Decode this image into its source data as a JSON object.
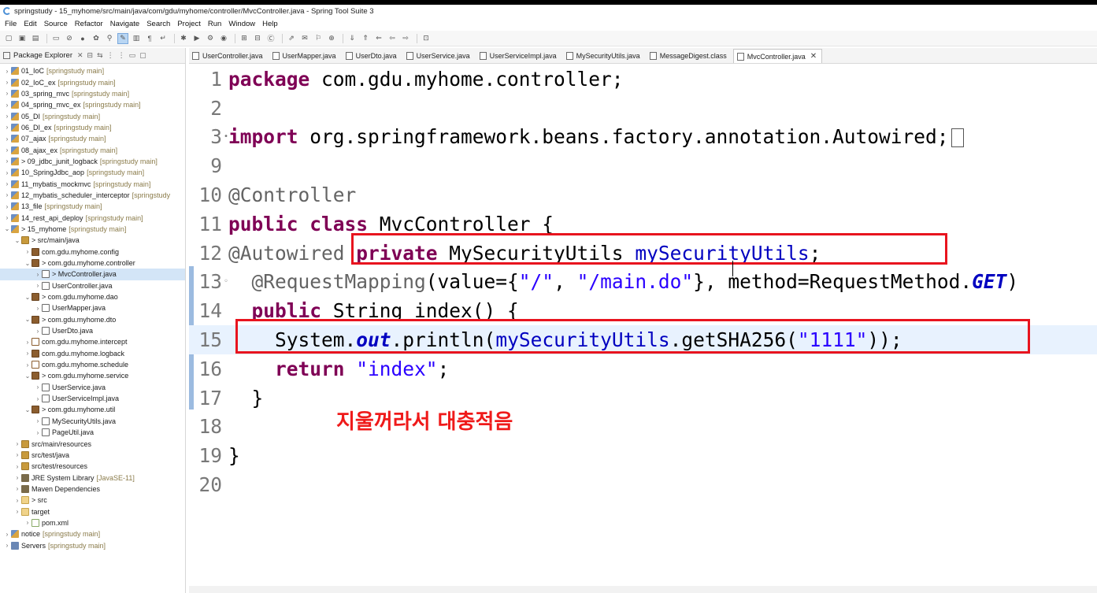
{
  "window": {
    "title": "springstudy - 15_myhome/src/main/java/com/gdu/myhome/controller/MvcController.java - Spring Tool Suite 3"
  },
  "menu": [
    "File",
    "Edit",
    "Source",
    "Refactor",
    "Navigate",
    "Search",
    "Project",
    "Run",
    "Window",
    "Help"
  ],
  "package_explorer": {
    "title": "Package Explorer",
    "rows": [
      {
        "name": "01_IoC",
        "tag": "[springstudy main]",
        "indent": 0,
        "icon": "proj"
      },
      {
        "name": "02_IoC_ex",
        "tag": "[springstudy main]",
        "indent": 0,
        "icon": "proj"
      },
      {
        "name": "03_spring_mvc",
        "tag": "[springstudy main]",
        "indent": 0,
        "icon": "proj"
      },
      {
        "name": "04_spring_mvc_ex",
        "tag": "[springstudy main]",
        "indent": 0,
        "icon": "proj"
      },
      {
        "name": "05_DI",
        "tag": "[springstudy main]",
        "indent": 0,
        "icon": "proj"
      },
      {
        "name": "06_DI_ex",
        "tag": "[springstudy main]",
        "indent": 0,
        "icon": "proj"
      },
      {
        "name": "07_ajax",
        "tag": "[springstudy main]",
        "indent": 0,
        "icon": "proj"
      },
      {
        "name": "08_ajax_ex",
        "tag": "[springstudy main]",
        "indent": 0,
        "icon": "proj"
      },
      {
        "name": "> 09_jdbc_junit_logback",
        "tag": "[springstudy main]",
        "indent": 0,
        "icon": "proj"
      },
      {
        "name": "10_SpringJdbc_aop",
        "tag": "[springstudy main]",
        "indent": 0,
        "icon": "proj"
      },
      {
        "name": "11_mybatis_mockmvc",
        "tag": "[springstudy main]",
        "indent": 0,
        "icon": "proj"
      },
      {
        "name": "12_mybatis_scheduler_interceptor",
        "tag": "[springstudy",
        "indent": 0,
        "icon": "proj"
      },
      {
        "name": "13_file",
        "tag": "[springstudy main]",
        "indent": 0,
        "icon": "proj"
      },
      {
        "name": "14_rest_api_deploy",
        "tag": "[springstudy main]",
        "indent": 0,
        "icon": "proj"
      },
      {
        "name": "> 15_myhome",
        "tag": "[springstudy main]",
        "indent": 0,
        "icon": "proj",
        "open": true
      },
      {
        "name": "> src/main/java",
        "tag": "",
        "indent": 1,
        "icon": "srcf",
        "open": true
      },
      {
        "name": "com.gdu.myhome.config",
        "tag": "",
        "indent": 2,
        "icon": "pkg"
      },
      {
        "name": "> com.gdu.myhome.controller",
        "tag": "",
        "indent": 2,
        "icon": "pkg",
        "open": true
      },
      {
        "name": "> MvcController.java",
        "tag": "",
        "indent": 3,
        "icon": "jfile",
        "selected": true
      },
      {
        "name": "UserController.java",
        "tag": "",
        "indent": 3,
        "icon": "jfile"
      },
      {
        "name": "> com.gdu.myhome.dao",
        "tag": "",
        "indent": 2,
        "icon": "pkg",
        "open": true
      },
      {
        "name": "UserMapper.java",
        "tag": "",
        "indent": 3,
        "icon": "jfile"
      },
      {
        "name": "> com.gdu.myhome.dto",
        "tag": "",
        "indent": 2,
        "icon": "pkg",
        "open": true
      },
      {
        "name": "UserDto.java",
        "tag": "",
        "indent": 3,
        "icon": "jfile"
      },
      {
        "name": "com.gdu.myhome.intercept",
        "tag": "",
        "indent": 2,
        "icon": "pkge"
      },
      {
        "name": "com.gdu.myhome.logback",
        "tag": "",
        "indent": 2,
        "icon": "pkg"
      },
      {
        "name": "com.gdu.myhome.schedule",
        "tag": "",
        "indent": 2,
        "icon": "pkge"
      },
      {
        "name": "> com.gdu.myhome.service",
        "tag": "",
        "indent": 2,
        "icon": "pkg",
        "open": true
      },
      {
        "name": "UserService.java",
        "tag": "",
        "indent": 3,
        "icon": "jfile"
      },
      {
        "name": "UserServiceImpl.java",
        "tag": "",
        "indent": 3,
        "icon": "jfile"
      },
      {
        "name": "> com.gdu.myhome.util",
        "tag": "",
        "indent": 2,
        "icon": "pkg",
        "open": true
      },
      {
        "name": "MySecurityUtils.java",
        "tag": "",
        "indent": 3,
        "icon": "jfile"
      },
      {
        "name": "PageUtil.java",
        "tag": "",
        "indent": 3,
        "icon": "jfile"
      },
      {
        "name": "src/main/resources",
        "tag": "",
        "indent": 1,
        "icon": "srcf"
      },
      {
        "name": "src/test/java",
        "tag": "",
        "indent": 1,
        "icon": "srcf"
      },
      {
        "name": "src/test/resources",
        "tag": "",
        "indent": 1,
        "icon": "srcf"
      },
      {
        "name": "JRE System Library",
        "tag": "[JavaSE-11]",
        "indent": 1,
        "icon": "lib"
      },
      {
        "name": "Maven Dependencies",
        "tag": "",
        "indent": 1,
        "icon": "lib"
      },
      {
        "name": "> src",
        "tag": "",
        "indent": 1,
        "icon": "fold"
      },
      {
        "name": "target",
        "tag": "",
        "indent": 1,
        "icon": "fold"
      },
      {
        "name": "pom.xml",
        "tag": "",
        "indent": 2,
        "icon": "xml"
      },
      {
        "name": "notice",
        "tag": "[springstudy main]",
        "indent": 0,
        "icon": "proj"
      },
      {
        "name": "Servers",
        "tag": "[springstudy main]",
        "indent": 0,
        "icon": "serv"
      }
    ]
  },
  "editor_tabs": [
    "UserController.java",
    "UserMapper.java",
    "UserDto.java",
    "UserService.java",
    "UserServiceImpl.java",
    "MySecurityUtils.java",
    "MessageDigest.class",
    "MvcController.java"
  ],
  "active_tab": "MvcController.java",
  "code": {
    "line_numbers": [
      "1",
      "2",
      "3",
      "9",
      "10",
      "11",
      "12",
      "13",
      "14",
      "15",
      "16",
      "17",
      "18",
      "19",
      "20"
    ],
    "kw_package": "package",
    "pkg_name": " com.gdu.myhome.controller;",
    "kw_import": "import",
    "import_name": " org.springframework.beans.factory.annotation.Autowired;",
    "ann_controller": "@Controller",
    "kw_public": "public",
    "kw_class": "class",
    "class_name": " MvcController {",
    "ann_autowired": "@Autowired",
    "kw_private": "private",
    "type_msu": " MySecurityUtils ",
    "field_msu": "mySecurityUtils",
    "semi": ";",
    "ann_reqmap": "@RequestMapping",
    "reqmap_args_a": "(value={",
    "str_root": "\"/\"",
    "comma": ", ",
    "str_main": "\"/main.do\"",
    "reqmap_args_b": "}, method=RequestMethod.",
    "get": "GET",
    "close_paren": ")",
    "type_string": " String index() {",
    "sys": "System.",
    "out": "out",
    "println": ".println(",
    "getsha": ".getSHA256(",
    "str_1111": "\"1111\"",
    "close_call": "));",
    "kw_return": "return",
    "str_index": "\"index\"",
    "brace_close": "}",
    "brace_class_close": "}"
  },
  "annotation_note": "지울꺼라서 대충적음",
  "colors": {
    "keyword": "#7f0055",
    "string": "#2a00ff",
    "field": "#0000c0",
    "annotation": "#646464",
    "redbox": "#e8141e"
  }
}
